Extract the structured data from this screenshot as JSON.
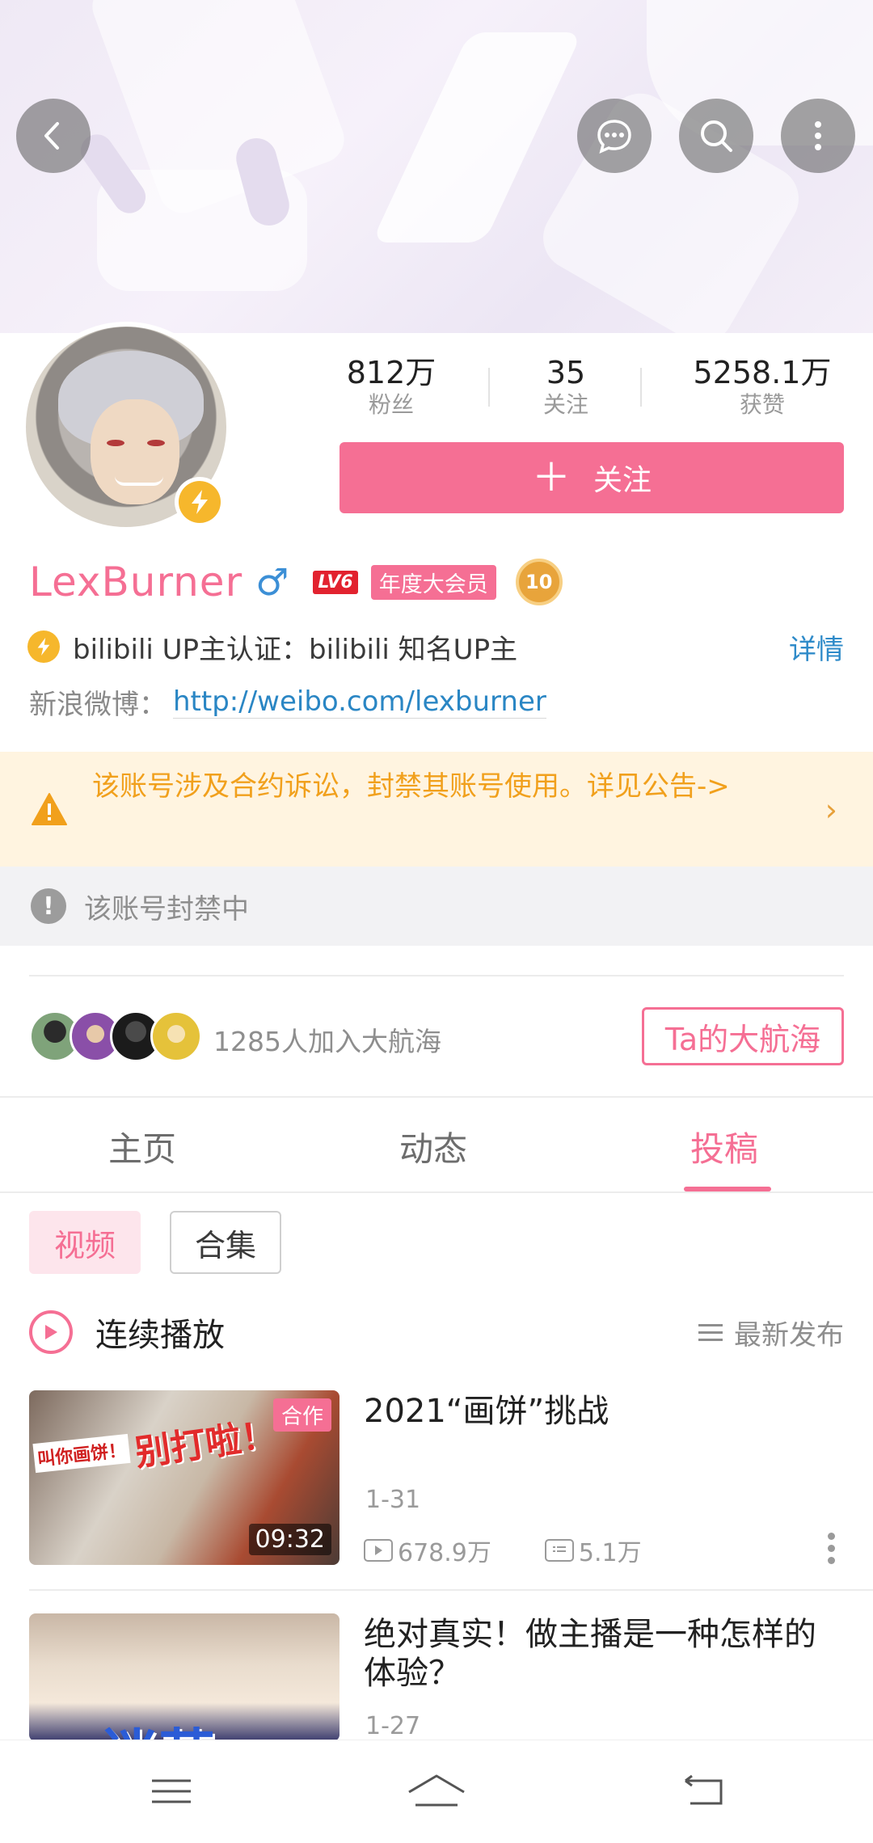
{
  "colors": {
    "accent": "#f56f94",
    "link": "#2f8bc9",
    "warning": "#f1a01c",
    "warning_bg": "#fff4e0"
  },
  "header": {
    "icons": [
      "back-icon",
      "message-icon",
      "search-icon",
      "more-icon"
    ]
  },
  "profile": {
    "username": "LexBurner",
    "gender_symbol": "♂",
    "level": "LV6",
    "vip_label": "年度大会员",
    "medal_label": "10",
    "stats": [
      {
        "value": "812万",
        "label": "粉丝"
      },
      {
        "value": "35",
        "label": "关注"
      },
      {
        "value": "5258.1万",
        "label": "获赞"
      }
    ],
    "follow_plus": "＋",
    "follow_label": "关注",
    "certification": "bilibili UP主认证：bilibili 知名UP主",
    "detail_link": "详情",
    "weibo_label": "新浪微博：",
    "weibo_url": "http://weibo.com/lexburner"
  },
  "notice": {
    "warning_text": "该账号涉及合约诉讼，封禁其账号使用。详见公告->",
    "chevron": "›",
    "banned_icon": "!",
    "banned_text": "该账号封禁中"
  },
  "guard": {
    "count_text": "1285人加入大航海",
    "button_label": "Ta的大航海"
  },
  "tabs": [
    {
      "label": "主页",
      "active": false
    },
    {
      "label": "动态",
      "active": false
    },
    {
      "label": "投稿",
      "active": true
    }
  ],
  "filters": [
    {
      "label": "视频",
      "active": true
    },
    {
      "label": "合集",
      "active": false
    }
  ],
  "playlist": {
    "play_label": "连续播放",
    "sort_label": "最新发布"
  },
  "videos": [
    {
      "title": "2021“画饼”挑战",
      "date": "1-31",
      "views": "678.9万",
      "comments": "5.1万",
      "duration": "09:32",
      "badge": "合作",
      "thumb_text_main": "别打啦！",
      "thumb_text_side": "叫你画饼！"
    },
    {
      "title": "绝对真实！做主播是一种怎样的体验？",
      "date": "1-27",
      "thumb_text_main": "迷茫"
    }
  ]
}
